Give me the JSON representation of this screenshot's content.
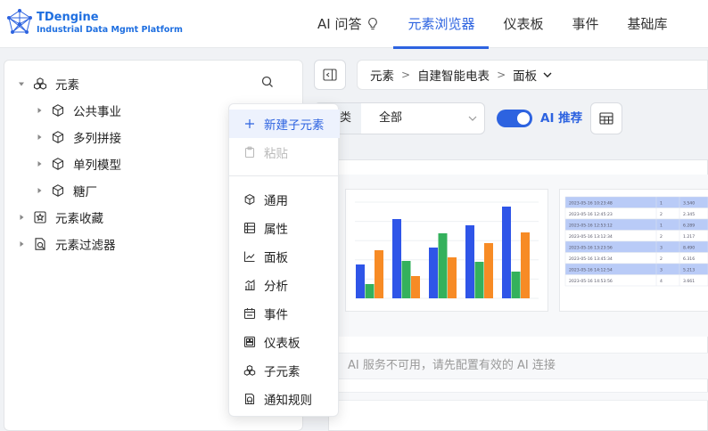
{
  "brand": {
    "name": "TDengine",
    "subtitle": "Industrial Data Mgmt Platform"
  },
  "nav": {
    "items": [
      {
        "label": "AI 问答",
        "icon": "lightbulb-icon"
      },
      {
        "label": "元素浏览器",
        "active": true
      },
      {
        "label": "仪表板"
      },
      {
        "label": "事件"
      },
      {
        "label": "基础库"
      }
    ]
  },
  "tree": {
    "root": {
      "label": "元素",
      "icon": "cluster-icon",
      "expanded": true
    },
    "children": [
      {
        "label": "公共事业",
        "icon": "cube-icon"
      },
      {
        "label": "多列拼接",
        "icon": "cube-icon"
      },
      {
        "label": "单列模型",
        "icon": "cube-icon"
      },
      {
        "label": "糖厂",
        "icon": "cube-icon"
      }
    ],
    "others": [
      {
        "label": "元素收藏",
        "icon": "star-badge-icon"
      },
      {
        "label": "元素过滤器",
        "icon": "filter-doc-icon"
      }
    ]
  },
  "breadcrumb": {
    "items": [
      "元素",
      "自建智能电表",
      "面板"
    ]
  },
  "filter": {
    "label": "类",
    "value": "全部"
  },
  "ai_toggle": {
    "label": "AI 推荐",
    "on": true
  },
  "ai_message": "AI 服务不可用，请先配置有效的 AI 连接",
  "context_menu": {
    "items_top": [
      {
        "label": "新建子元素",
        "icon": "plus-icon",
        "highlighted": true
      },
      {
        "label": "粘贴",
        "icon": "paste-icon",
        "disabled": true
      }
    ],
    "items_bottom": [
      {
        "label": "通用",
        "icon": "cube-icon"
      },
      {
        "label": "属性",
        "icon": "list-icon"
      },
      {
        "label": "面板",
        "icon": "line-chart-icon"
      },
      {
        "label": "分析",
        "icon": "analysis-icon"
      },
      {
        "label": "事件",
        "icon": "calendar-icon"
      },
      {
        "label": "仪表板",
        "icon": "dashboard-icon"
      },
      {
        "label": "子元素",
        "icon": "cluster-icon"
      },
      {
        "label": "通知规则",
        "icon": "notify-icon"
      }
    ]
  },
  "thumbnail_table": {
    "rows": [
      [
        "2023-05-16 10:23:48",
        "1",
        "3.540"
      ],
      [
        "2023-05-16 12:45:23",
        "2",
        "2.345"
      ],
      [
        "2023-05-16 12:53:12",
        "1",
        "6.289"
      ],
      [
        "2023-05-16 13:12:34",
        "2",
        "1.217"
      ],
      [
        "2023-05-16 13:23:56",
        "3",
        "8.490"
      ],
      [
        "2023-05-16 13:45:34",
        "2",
        "6.316"
      ],
      [
        "2023-05-16 14:12:54",
        "3",
        "5.213"
      ],
      [
        "2023-05-16 14:53:56",
        "4",
        "3.661"
      ]
    ]
  },
  "thumbnail_chart": {
    "series_colors": [
      "#2f55e8",
      "#34b15c",
      "#f78b25"
    ],
    "groups": [
      [
        38,
        16,
        54
      ],
      [
        89,
        42,
        25
      ],
      [
        57,
        73,
        46
      ],
      [
        82,
        41,
        62
      ],
      [
        103,
        30,
        74
      ]
    ]
  }
}
